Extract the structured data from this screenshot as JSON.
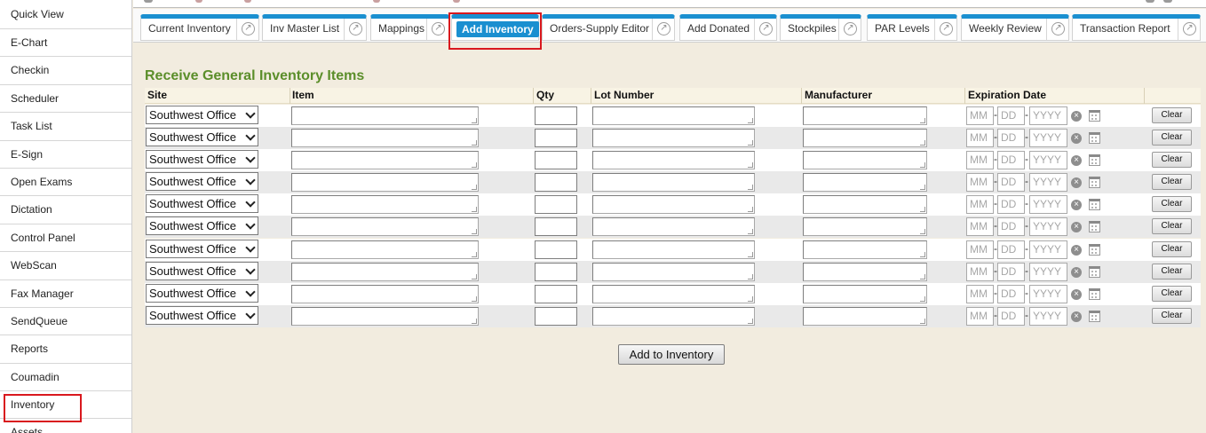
{
  "sidebar": {
    "items": [
      {
        "label": "Quick View"
      },
      {
        "label": "E-Chart"
      },
      {
        "label": "Checkin"
      },
      {
        "label": "Scheduler"
      },
      {
        "label": "Task List"
      },
      {
        "label": "E-Sign"
      },
      {
        "label": "Open Exams"
      },
      {
        "label": "Dictation"
      },
      {
        "label": "Control Panel"
      },
      {
        "label": "WebScan"
      },
      {
        "label": "Fax Manager"
      },
      {
        "label": "SendQueue"
      },
      {
        "label": "Reports"
      },
      {
        "label": "Coumadin"
      },
      {
        "label": "Inventory"
      },
      {
        "label": "Assets"
      }
    ],
    "highlighted": "Inventory"
  },
  "tabs": [
    {
      "label": "Current Inventory"
    },
    {
      "label": "Inv Master List"
    },
    {
      "label": "Mappings"
    },
    {
      "label": "Add Inventory"
    },
    {
      "label": "Orders-Supply Editor"
    },
    {
      "label": "Add Donated"
    },
    {
      "label": "Stockpiles"
    },
    {
      "label": "PAR Levels"
    },
    {
      "label": "Weekly Review"
    },
    {
      "label": "Transaction Report"
    }
  ],
  "active_tab": "Add Inventory",
  "form": {
    "title": "Receive General Inventory Items",
    "columns": {
      "site": "Site",
      "item": "Item",
      "qty": "Qty",
      "lot": "Lot Number",
      "manufacturer": "Manufacturer",
      "expiration": "Expiration Date"
    },
    "rows": [
      {
        "site": "Southwest Office"
      },
      {
        "site": "Southwest Office"
      },
      {
        "site": "Southwest Office"
      },
      {
        "site": "Southwest Office"
      },
      {
        "site": "Southwest Office"
      },
      {
        "site": "Southwest Office"
      },
      {
        "site": "Southwest Office"
      },
      {
        "site": "Southwest Office"
      },
      {
        "site": "Southwest Office"
      },
      {
        "site": "Southwest Office"
      }
    ],
    "date_placeholders": {
      "month": "MM",
      "day": "DD",
      "year": "YYYY"
    },
    "date_separator": "-",
    "clear_label": "Clear",
    "submit_label": "Add to Inventory"
  },
  "colors": {
    "accent": "#1a8fd0",
    "title_green": "#5b8e2a",
    "highlight_red": "#d9181e",
    "content_bg": "#f2ecdf"
  },
  "icons": [
    "popout-icon",
    "clear-date-icon",
    "calendar-icon",
    "chevron-down-icon"
  ]
}
